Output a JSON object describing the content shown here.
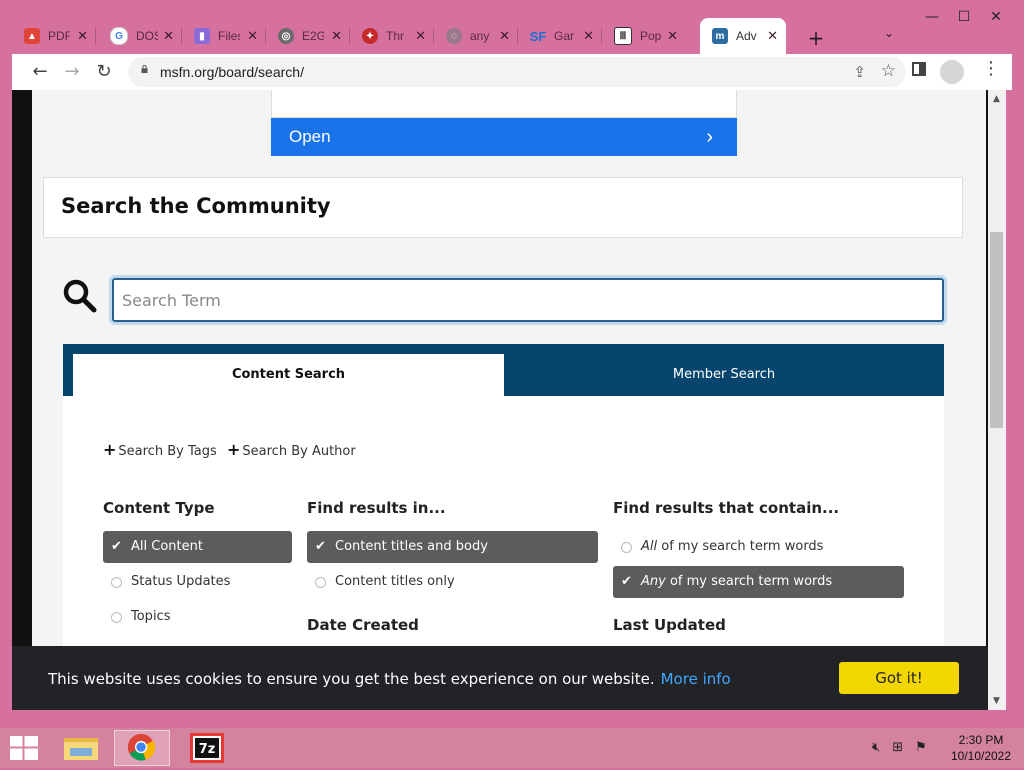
{
  "browser": {
    "tabs": [
      {
        "title": "PDF",
        "icon": "triangle-app-icon",
        "color": "#e0453c"
      },
      {
        "title": "DOS",
        "icon": "google-icon",
        "color": "#4285f4"
      },
      {
        "title": "Files",
        "icon": "file-icon",
        "color": "#6c4bd1"
      },
      {
        "title": "E2G",
        "icon": "globe-icon",
        "color": "#6a6a6a"
      },
      {
        "title": "Thr",
        "icon": "shield-icon",
        "color": "#c62828"
      },
      {
        "title": "any",
        "icon": "spinner-icon",
        "color": "#9a7a8a"
      },
      {
        "title": "Gar",
        "icon": "sourceforge-icon",
        "color": "#1d6fd1"
      },
      {
        "title": "Pop",
        "icon": "museum-icon",
        "color": "#333333"
      },
      {
        "title": "Adv",
        "icon": "msfn-icon",
        "color": "#2f6ea5",
        "active": true
      }
    ],
    "new_tab_label": "+",
    "window_controls": {
      "minimize": "—",
      "maximize": "☐",
      "close": "✕"
    },
    "nav": {
      "back": "←",
      "forward": "→",
      "reload": "↻"
    },
    "url": "msfn.org/board/search/"
  },
  "page": {
    "ad": {
      "open_label": "Open"
    },
    "title": "Search the Community",
    "search": {
      "placeholder": "Search Term",
      "value": ""
    },
    "tabs": {
      "content": "Content Search",
      "member": "Member Search"
    },
    "links": {
      "tags": "Search By Tags",
      "author": "Search By Author"
    },
    "content_type": {
      "heading": "Content Type",
      "options": [
        "All Content",
        "Status Updates",
        "Topics"
      ],
      "selected": "All Content"
    },
    "find_in": {
      "heading": "Find results in...",
      "options": [
        "Content titles and body",
        "Content titles only"
      ],
      "selected": "Content titles and body"
    },
    "contain": {
      "heading": "Find results that contain...",
      "opt_all_em": "All",
      "opt_all_rest": " of my search term words",
      "opt_any_em": "Any",
      "opt_any_rest": " of my search term words",
      "selected": "Any"
    },
    "date_created": "Date Created",
    "last_updated": "Last Updated"
  },
  "cookie": {
    "text": "This website uses cookies to ensure you get the best experience on our website.",
    "more": "More info",
    "button": "Got it!",
    "accent": "#f1d600"
  },
  "taskbar": {
    "time": "2:30 PM",
    "date": "10/10/2022"
  },
  "colors": {
    "frame": "#d5709f",
    "tab_bar": "#07456e",
    "selected_option": "#5c5c5c",
    "link": "#3ea6ff",
    "ad_button": "#1a73e8"
  }
}
